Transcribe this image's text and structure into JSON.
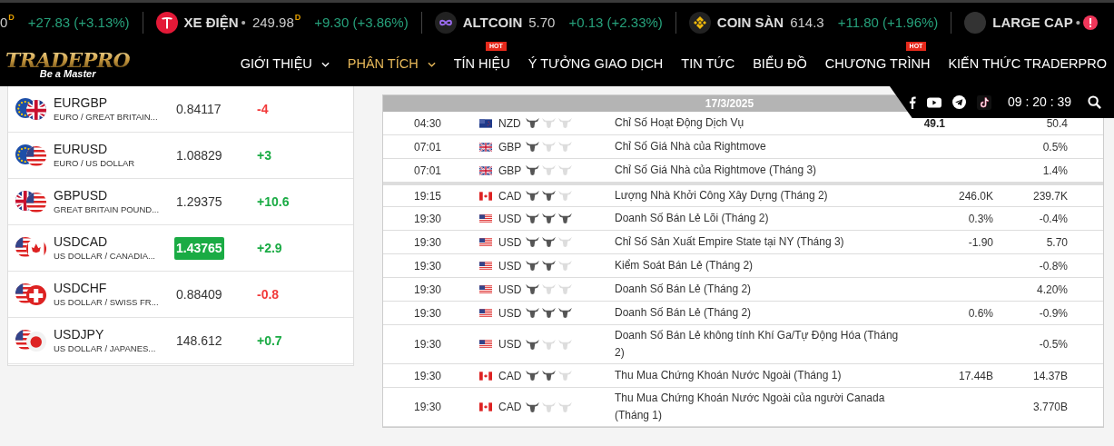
{
  "ticker": [
    {
      "kind": "none",
      "price": "0",
      "price_mark": "D",
      "change": "+27.83 (+3.13%)",
      "alert": false
    },
    {
      "kind": "tesla",
      "name": "XE ĐIỆN",
      "separator": "•",
      "price": "249.98",
      "price_mark": "D",
      "change": "+9.30 (+3.86%)",
      "alert": false
    },
    {
      "kind": "infinity",
      "name": "ALTCOIN",
      "price": "5.70",
      "change": "+0.13 (+2.33%)",
      "alert": false
    },
    {
      "kind": "coin",
      "name": "COIN SÀN",
      "price": "614.3",
      "change": "+11.80 (+1.96%)",
      "alert": false
    },
    {
      "kind": "blank",
      "name": "LARGE CAP",
      "separator": "•",
      "alert": true
    }
  ],
  "logo": {
    "title": "TRADEPRO",
    "tagline": "Be a Master"
  },
  "nav": [
    {
      "label": "GIỚI THIỆU",
      "dropdown": true,
      "selected": false
    },
    {
      "label": "PHÂN TÍCH",
      "dropdown": true,
      "selected": true
    },
    {
      "label": "TÍN HIỆU",
      "dropdown": false,
      "badge": "HOT",
      "selected": false
    },
    {
      "label": "Ý TƯỞNG GIAO DỊCH",
      "dropdown": false,
      "selected": false
    },
    {
      "label": "TIN TỨC",
      "dropdown": false,
      "selected": false
    },
    {
      "label": "BIỂU ĐỒ",
      "dropdown": false,
      "selected": false
    },
    {
      "label": "CHƯƠNG TRÌNH",
      "dropdown": false,
      "badge": "HOT",
      "selected": false
    },
    {
      "label": "KIẾN THỨC TRADERPRO",
      "dropdown": false,
      "selected": false
    }
  ],
  "social": {
    "clock": "09 : 20 : 39"
  },
  "quotes": [
    {
      "kind": "eugb",
      "symbol": "EURGBP",
      "name": "EURO / GREAT BRITAIN...",
      "price": "0.84117",
      "highlighted": false,
      "change": "-4",
      "color": "#f23a3a"
    },
    {
      "kind": "euus",
      "symbol": "EURUSD",
      "name": "EURO / US DOLLAR",
      "price": "1.08829",
      "highlighted": false,
      "change": "+3",
      "color": "#1aab44"
    },
    {
      "kind": "gbus",
      "symbol": "GBPUSD",
      "name": "GREAT BRITAIN POUND...",
      "price": "1.29375",
      "highlighted": false,
      "change": "+10.6",
      "color": "#1aab44"
    },
    {
      "kind": "usca",
      "symbol": "USDCAD",
      "name": "US DOLLAR / CANADIA...",
      "price": "1.43765",
      "highlighted": true,
      "change": "+2.9",
      "color": "#1aab44"
    },
    {
      "kind": "usch",
      "symbol": "USDCHF",
      "name": "US DOLLAR / SWISS FR...",
      "price": "0.88409",
      "highlighted": false,
      "change": "-0.8",
      "color": "#f23a3a"
    },
    {
      "kind": "usjp",
      "symbol": "USDJPY",
      "name": "US DOLLAR / JAPANES...",
      "price": "148.612",
      "highlighted": false,
      "change": "+0.7",
      "color": "#1aab44"
    }
  ],
  "calendar": {
    "date": "17/3/2025",
    "rows": [
      {
        "time": "04:30",
        "kind": "nz",
        "currency": "NZD",
        "stars": 1,
        "event": "Chỉ Số Hoạt Động Dịch Vụ",
        "column_5": "49.1",
        "column_7": "50.4",
        "group_start": false
      },
      {
        "time": "07:01",
        "kind": "gb",
        "currency": "GBP",
        "stars": 1,
        "event": "Chỉ Số Giá Nhà của Rightmove",
        "column_7": "0.5%",
        "group_start": false
      },
      {
        "time": "07:01",
        "kind": "gb",
        "currency": "GBP",
        "stars": 1,
        "event": "Chỉ Số Giá Nhà của Rightmove (Tháng 3)",
        "column_7": "1.4%",
        "group_start": false
      },
      {
        "time": "19:15",
        "kind": "ca",
        "currency": "CAD",
        "stars": 2,
        "event": "Lượng Nhà Khởi Công Xây Dựng (Tháng 2)",
        "column_6": "246.0K",
        "column_7": "239.7K",
        "group_start": true
      },
      {
        "time": "19:30",
        "kind": "us",
        "currency": "USD",
        "stars": 3,
        "event": "Doanh Số Bán Lẻ Lõi (Tháng 2)",
        "column_6": "0.3%",
        "column_7": "-0.4%",
        "group_start": false
      },
      {
        "time": "19:30",
        "kind": "us",
        "currency": "USD",
        "stars": 2,
        "event": "Chỉ Số Sản Xuất Empire State tại NY (Tháng 3)",
        "column_6": "-1.90",
        "column_7": "5.70",
        "group_start": false
      },
      {
        "time": "19:30",
        "kind": "us",
        "currency": "USD",
        "stars": 2,
        "event": "Kiểm Soát Bán Lẻ (Tháng 2)",
        "column_7": "-0.8%",
        "group_start": false
      },
      {
        "time": "19:30",
        "kind": "us",
        "currency": "USD",
        "stars": 1,
        "event": "Doanh Số Bán Lẻ (Tháng 2)",
        "column_7": "4.20%",
        "group_start": false
      },
      {
        "time": "19:30",
        "kind": "us",
        "currency": "USD",
        "stars": 3,
        "event": "Doanh Số Bán Lẻ (Tháng 2)",
        "column_6": "0.6%",
        "column_7": "-0.9%",
        "group_start": false
      },
      {
        "time": "19:30",
        "kind": "us",
        "currency": "USD",
        "stars": 1,
        "event": "Doanh Số Bán Lẻ không tính Khí Ga/Tự Động Hóa (Tháng 2)",
        "column_7": "-0.5%",
        "group_start": false
      },
      {
        "time": "19:30",
        "kind": "ca",
        "currency": "CAD",
        "stars": 2,
        "event": "Thu Mua Chứng Khoán Nước Ngoài (Tháng 1)",
        "column_6": "17.44B",
        "column_7": "14.37B",
        "group_start": false
      },
      {
        "time": "19:30",
        "kind": "ca",
        "currency": "CAD",
        "stars": 1,
        "event": "Thu Mua Chứng Khoán Nước Ngoài của người Canada (Tháng 1)",
        "column_7": "3.770B",
        "group_start": false
      }
    ]
  }
}
